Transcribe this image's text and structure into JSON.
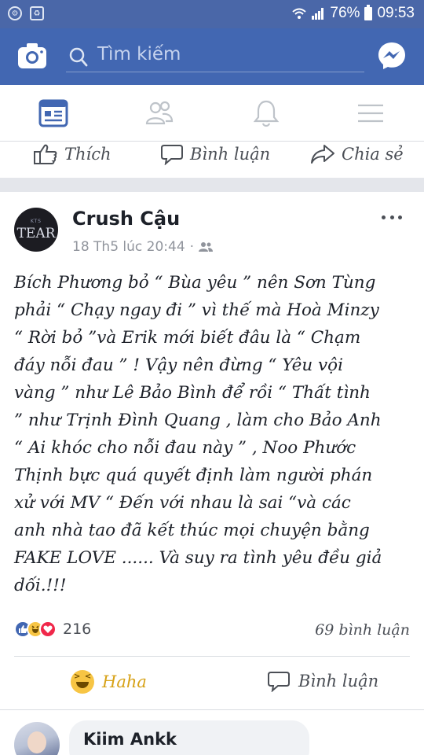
{
  "status_bar": {
    "battery": "76%",
    "time": "09:53"
  },
  "appbar": {
    "search_placeholder": "Tìm kiếm",
    "icons": [
      "camera-icon",
      "search-icon",
      "messenger-icon"
    ]
  },
  "tabs": [
    {
      "name": "news-feed",
      "icon": "news-feed-icon",
      "active": true
    },
    {
      "name": "friends",
      "icon": "friends-icon",
      "active": false
    },
    {
      "name": "notifications",
      "icon": "bell-icon",
      "active": false
    },
    {
      "name": "menu",
      "icon": "menu-icon",
      "active": false
    }
  ],
  "previous_post_actions": {
    "like": "Thích",
    "comment": "Bình luận",
    "share": "Chia sẻ"
  },
  "post": {
    "author": "Crush Cậu",
    "avatar_text": {
      "small": "KTS",
      "main": "TEAR"
    },
    "timestamp": "18 Th5 lúc 20:44",
    "audience_icon": "friends-icon",
    "body_lines": [
      "Bích Phương bỏ “ Bùa yêu ” nên Sơn Tùng",
      "phải “ Chạy ngay đi ” vì thế mà Hoà Minzy",
      "“ Rời bỏ ”và Erik mới biết đâu là “ Chạm",
      "đáy nỗi đau ” ! Vậy nên đừng “ Yêu vội",
      "vàng ” như Lê Bảo Bình để rồi “ Thất tình",
      "” như Trịnh Đình Quang , làm cho Bảo Anh",
      "“ Ai khóc cho nỗi đau này ” , Noo Phước",
      "Thịnh bực quá quyết định làm người phán",
      "xử với MV “ Đến với nhau là sai “và các",
      "anh nhà tao đã kết thúc mọi chuyện bằng",
      "FAKE LOVE ...... Và suy ra tình yêu đều giả",
      "dối.!!!"
    ],
    "reaction_count": "216",
    "comment_count": "69 bình luận",
    "actions": {
      "reaction": "Haha",
      "comment": "Bình luận"
    },
    "colors": {
      "haha": "#d7a217",
      "like": "#4267b2",
      "love": "#f0284a"
    }
  },
  "comment": {
    "author": "Kiim Ankk"
  }
}
